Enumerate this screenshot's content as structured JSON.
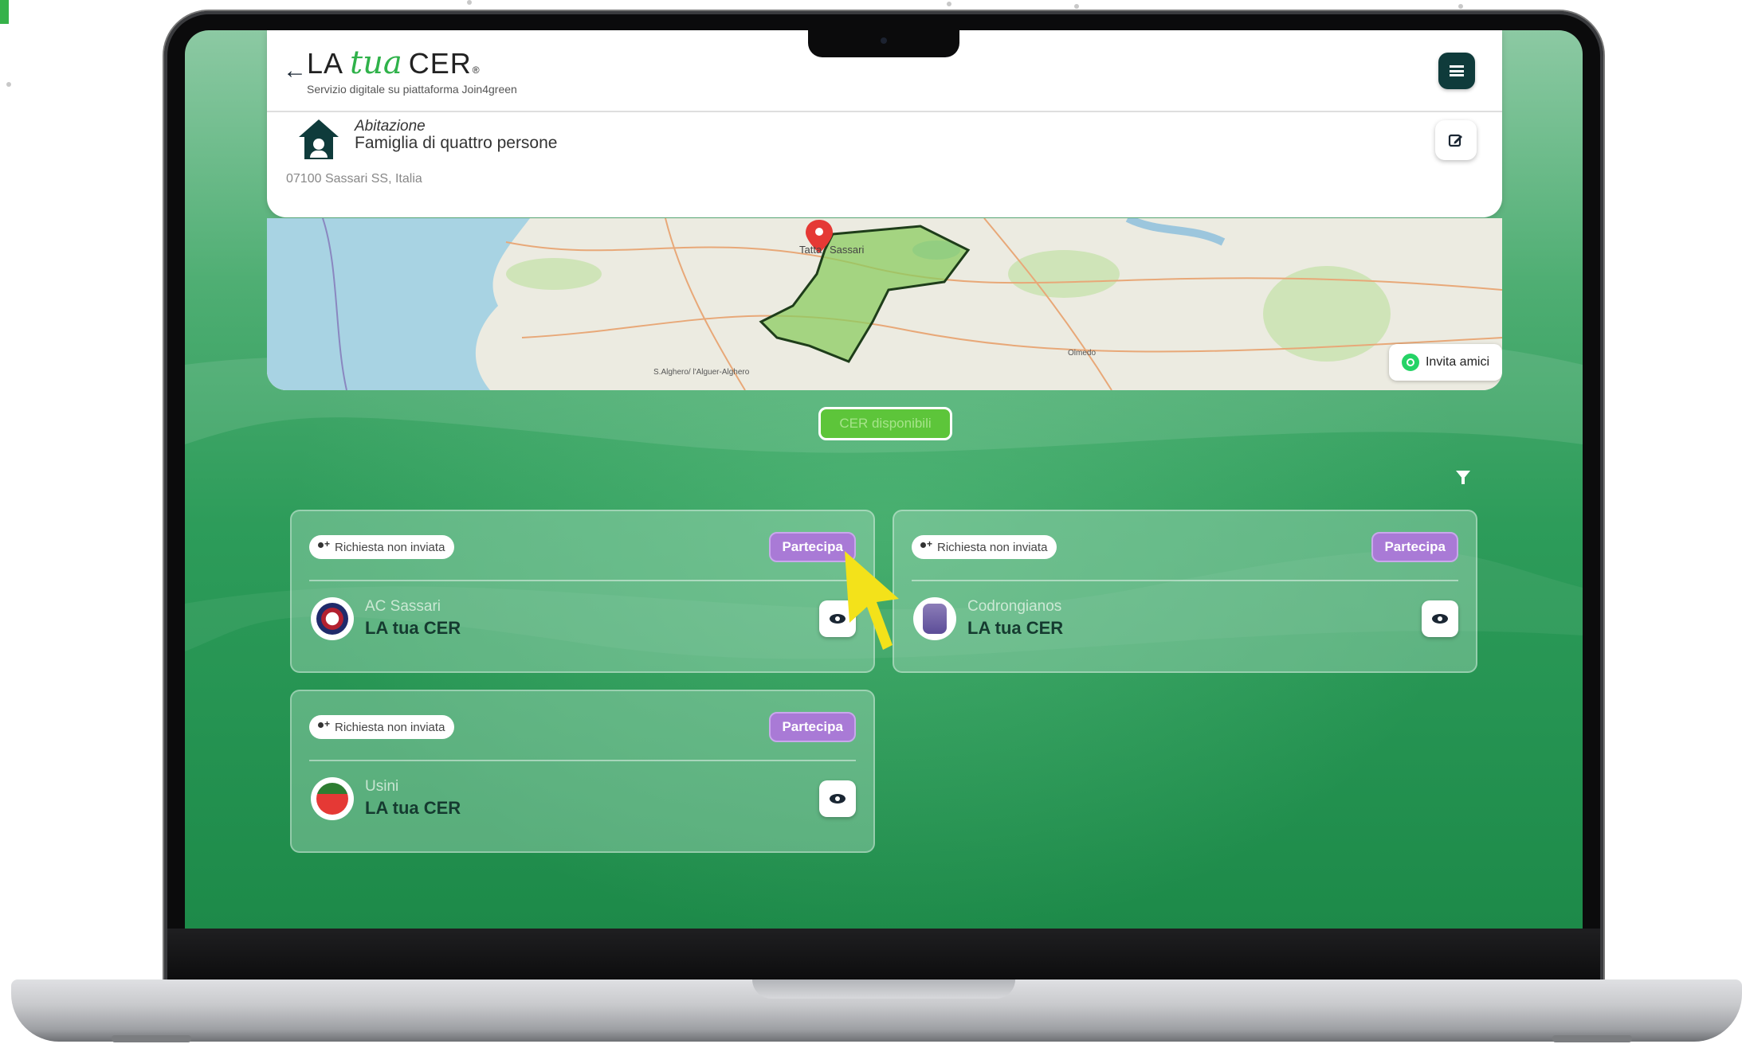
{
  "app": {
    "brand_la": "LA",
    "brand_tua": "tua",
    "brand_cer": "CER",
    "brand_reg": "®",
    "subtitle": "Servizio digitale su piattaforma Join4green"
  },
  "header": {
    "back_icon": "arrow-left-icon",
    "menu_icon": "hamburger-menu-icon",
    "edit_icon": "edit-icon"
  },
  "profile": {
    "icon": "house-icon",
    "type": "Abitazione",
    "description": "Famiglia di quattro persone",
    "address": "07100 Sassari SS, Italia"
  },
  "map": {
    "labels": [
      "Tatta",
      "Sassari",
      "S.Alghero/ l'Alguer-Alghero",
      "Olmedo"
    ],
    "invite_label": "Invita amici",
    "invite_icon": "whatsapp-icon",
    "pin_icon": "map-pin-icon"
  },
  "cer_button_label": "CER disponibili",
  "filter_icon": "filter-icon",
  "cards": [
    {
      "status": "Richiesta non inviata",
      "join_label": "Partecipa",
      "city": "AC Sassari",
      "title": "LA tua CER"
    },
    {
      "status": "Richiesta non inviata",
      "join_label": "Partecipa",
      "city": "Codrongianos",
      "title": "LA tua CER"
    },
    {
      "status": "Richiesta non inviata",
      "join_label": "Partecipa",
      "city": "Usini",
      "title": "LA tua CER"
    }
  ],
  "colors": {
    "brand_green": "#2fb24a",
    "primary_dark": "#0f3b3b",
    "join_purple": "#a97ad6",
    "cer_button_green": "#5dc53a",
    "cursor_yellow": "#f3e21a"
  }
}
